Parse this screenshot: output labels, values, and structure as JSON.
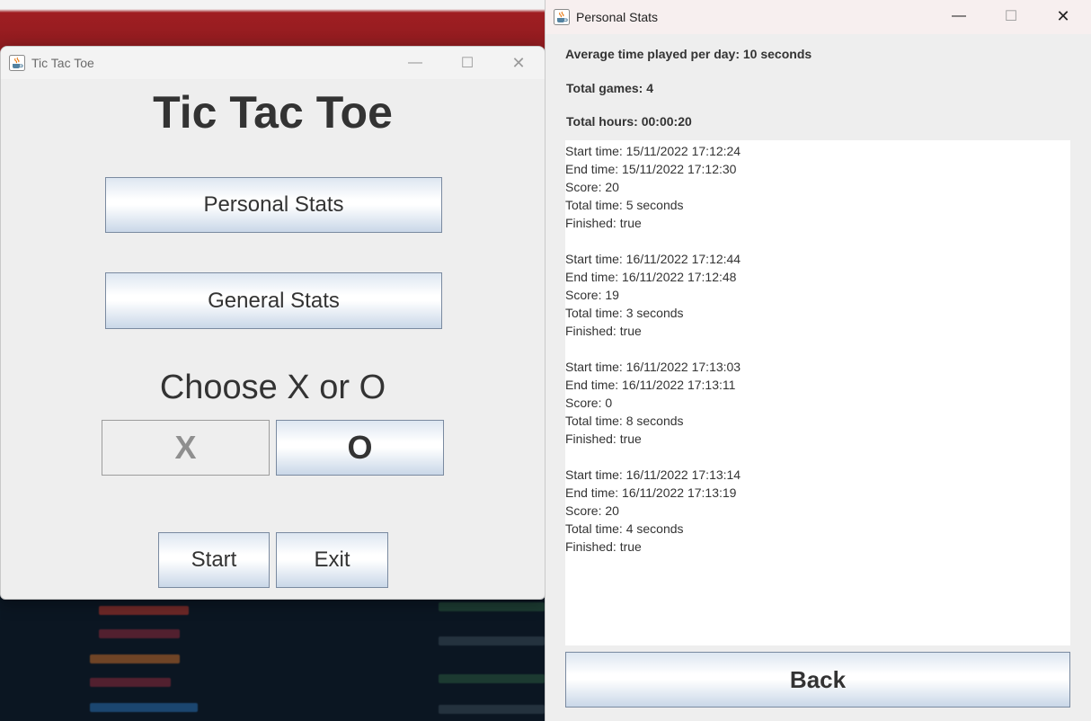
{
  "ttt_window": {
    "title": "Tic Tac Toe",
    "heading": "Tic Tac Toe",
    "personal_stats_label": "Personal Stats",
    "general_stats_label": "General Stats",
    "choose_label": "Choose X or O",
    "x_label": "X",
    "o_label": "O",
    "start_label": "Start",
    "exit_label": "Exit",
    "minimize_glyph": "—",
    "maximize_glyph": "☐",
    "close_glyph": "✕"
  },
  "stats_window": {
    "title": "Personal Stats",
    "avg_time": "Average time played per day: 10 seconds",
    "total_games": "Total games: 4",
    "total_hours": "Total hours: 00:00:20",
    "back_label": "Back",
    "minimize_glyph": "—",
    "maximize_glyph": "☐",
    "close_glyph": "✕",
    "records": [
      {
        "start": "Start time: 15/11/2022 17:12:24",
        "end": "End time: 15/11/2022 17:12:30",
        "score": "Score: 20",
        "total": "Total time: 5 seconds",
        "finished": "Finished: true"
      },
      {
        "start": "Start time: 16/11/2022 17:12:44",
        "end": "End time: 16/11/2022 17:12:48",
        "score": "Score: 19",
        "total": "Total time: 3 seconds",
        "finished": "Finished: true"
      },
      {
        "start": "Start time: 16/11/2022 17:13:03",
        "end": "End time: 16/11/2022 17:13:11",
        "score": "Score: 0",
        "total": "Total time: 8 seconds",
        "finished": "Finished: true"
      },
      {
        "start": "Start time: 16/11/2022 17:13:14",
        "end": "End time: 16/11/2022 17:13:19",
        "score": "Score: 20",
        "total": "Total time: 4 seconds",
        "finished": "Finished: true"
      }
    ]
  },
  "icons": {
    "app": "java-coffee-cup-icon"
  }
}
